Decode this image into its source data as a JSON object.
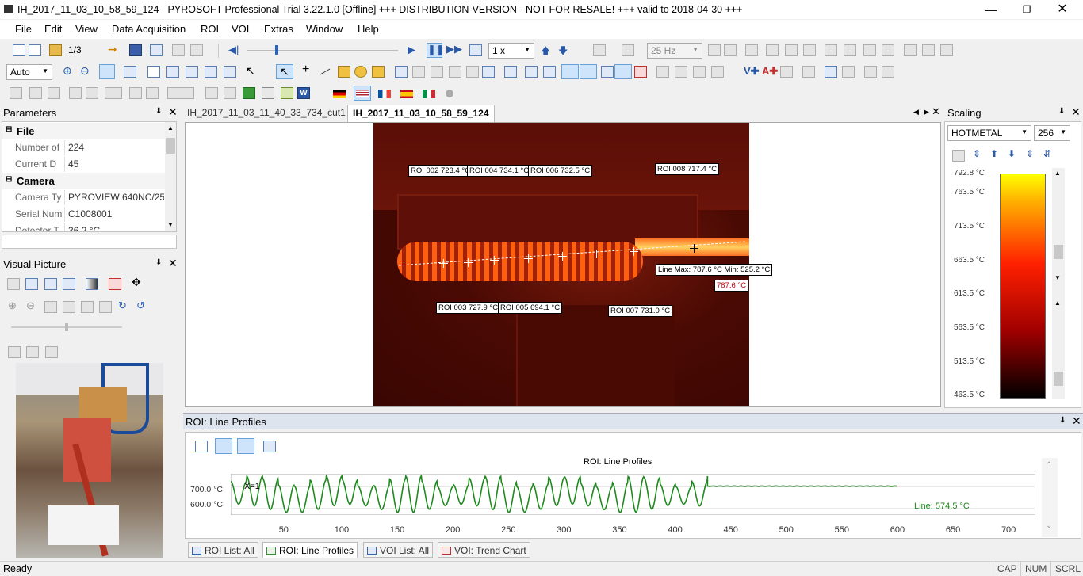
{
  "window": {
    "title": "IH_2017_11_03_10_58_59_124 - PYROSOFT Professional Trial 3.22.1.0  [Offline] +++ DISTRIBUTION-VERSION - NOT FOR RESALE! +++ valid to 2018-04-30 +++"
  },
  "menu": [
    "File",
    "Edit",
    "View",
    "Data Acquisition",
    "ROI",
    "VOI",
    "Extras",
    "Window",
    "Help"
  ],
  "toolbar": {
    "page": "1/3",
    "speed": "1 x",
    "freq": "25 Hz",
    "zoom_mode": "Auto"
  },
  "parameters": {
    "title": "Parameters",
    "cat_file": "File",
    "cat_camera": "Camera",
    "rows": [
      {
        "key": "Number of",
        "value": "224"
      },
      {
        "key": "Current D",
        "value": "45"
      },
      {
        "key": "Camera Ty",
        "value": "PYROVIEW 640NC/25"
      },
      {
        "key": "Serial Num",
        "value": "C1008001"
      },
      {
        "key": "Detector T",
        "value": "36.2 °C"
      }
    ]
  },
  "visual": {
    "title": "Visual Picture"
  },
  "doc_tabs": [
    {
      "label": "IH_2017_11_03_11_40_33_734_cut1"
    },
    {
      "label": "IH_2017_11_03_10_58_59_124"
    }
  ],
  "thermal": {
    "rois": [
      {
        "label": "ROI 002 723.4 °C"
      },
      {
        "label": "ROI 004 734.1 °C"
      },
      {
        "label": "ROI 006 732.5 °C"
      },
      {
        "label": "ROI 008 717.4 °C"
      },
      {
        "label": "ROI 003 727.9 °C"
      },
      {
        "label": "ROI 005 694.1 °C"
      },
      {
        "label": "ROI 007 731.0 °C"
      }
    ],
    "line_info": "Line Max: 787.6 °C Min: 525.2 °C",
    "max_label": "787.6 °C"
  },
  "scaling": {
    "title": "Scaling",
    "palette": "HOTMETAL",
    "levels": "256",
    "labels": [
      "792.8 °C",
      "763.5 °C",
      "713.5 °C",
      "663.5 °C",
      "613.5 °C",
      "563.5 °C",
      "513.5 °C",
      "463.5 °C"
    ],
    "colors": {
      "top": "#ffff00",
      "mid": "#ff2000",
      "bottom": "#000000"
    }
  },
  "line_profiles": {
    "panel_title": "ROI: Line Profiles",
    "cursor_label": "X=1",
    "line_label": "Line: 574.5 °C"
  },
  "chart_data": {
    "type": "line",
    "title": "ROI: Line Profiles",
    "x_ticks": [
      50,
      100,
      150,
      200,
      250,
      300,
      350,
      400,
      450,
      500,
      550,
      600,
      650,
      700
    ],
    "y_ticks": [
      "700.0 °C",
      "600.0 °C"
    ],
    "xlim": [
      1,
      725
    ],
    "ylim": [
      570,
      760
    ],
    "series": [
      {
        "color": "#1e8a1e",
        "oscillation": {
          "x_start": 1,
          "x_end": 430,
          "peaks": 30,
          "min_range": [
            580,
            620
          ],
          "max_range": [
            700,
            750
          ]
        },
        "plateau": {
          "x_start": 430,
          "x_end": 600,
          "value": 703
        }
      }
    ]
  },
  "bottom_tabs": [
    {
      "label": "ROI List: All"
    },
    {
      "label": "ROI: Line Profiles"
    },
    {
      "label": "VOI List: All"
    },
    {
      "label": "VOI: Trend Chart"
    }
  ],
  "status": {
    "text": "Ready",
    "cap": "CAP",
    "num": "NUM",
    "scrl": "SCRL"
  }
}
